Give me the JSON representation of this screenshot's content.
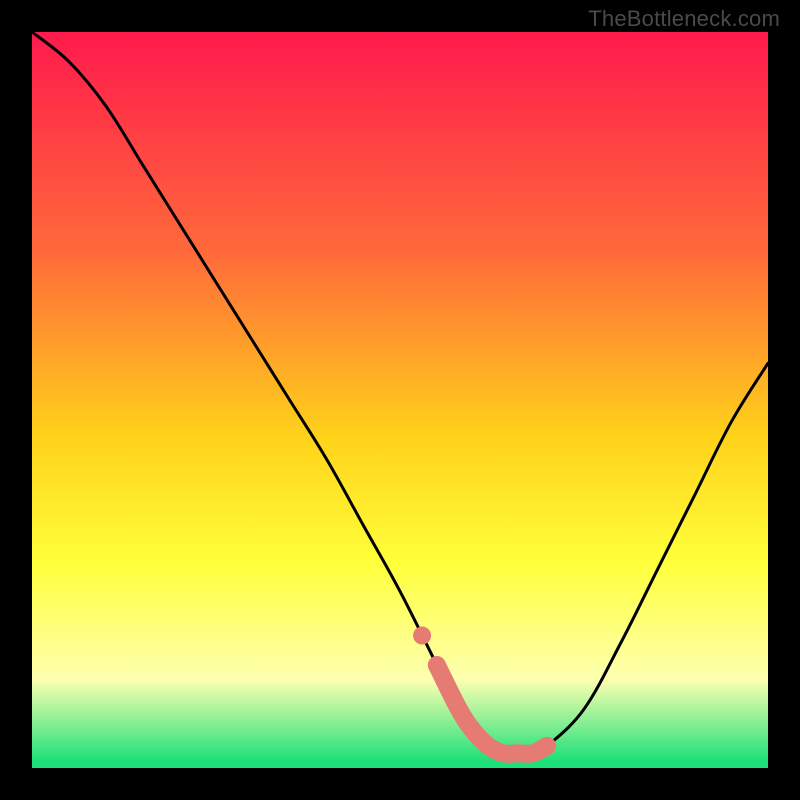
{
  "watermark": "TheBottleneck.com",
  "colors": {
    "black": "#000000",
    "curve": "#000000",
    "accent": "#e57b73",
    "grad_top": "#ff1a4d",
    "grad_mid1": "#ff6a3a",
    "grad_mid2": "#ffd21a",
    "grad_mid3": "#ffff3a",
    "grad_pale": "#fdffb0",
    "grad_green": "#1ee07a"
  },
  "chart_data": {
    "type": "line",
    "title": "",
    "xlabel": "",
    "ylabel": "",
    "xlim": [
      0,
      100
    ],
    "ylim": [
      0,
      100
    ],
    "series": [
      {
        "name": "bottleneck-curve",
        "x": [
          0,
          5,
          10,
          15,
          20,
          25,
          30,
          35,
          40,
          45,
          50,
          55,
          58,
          60,
          62,
          64,
          66,
          68,
          70,
          75,
          80,
          85,
          90,
          95,
          100
        ],
        "values": [
          100,
          96,
          90,
          82,
          74,
          66,
          58,
          50,
          42,
          33,
          24,
          14,
          8,
          5,
          3,
          2,
          2,
          2,
          3,
          8,
          17,
          27,
          37,
          47,
          55
        ]
      }
    ],
    "accent_segment": {
      "x_start": 55,
      "x_end": 70,
      "floor_value": 2
    },
    "background_gradient": {
      "stops": [
        {
          "offset": 0.0,
          "color_key": "grad_top"
        },
        {
          "offset": 0.3,
          "color_key": "grad_mid1"
        },
        {
          "offset": 0.55,
          "color_key": "grad_mid2"
        },
        {
          "offset": 0.72,
          "color_key": "grad_mid3"
        },
        {
          "offset": 0.88,
          "color_key": "grad_pale"
        },
        {
          "offset": 0.99,
          "color_key": "grad_green"
        },
        {
          "offset": 1.0,
          "color_key": "grad_green"
        }
      ]
    }
  }
}
